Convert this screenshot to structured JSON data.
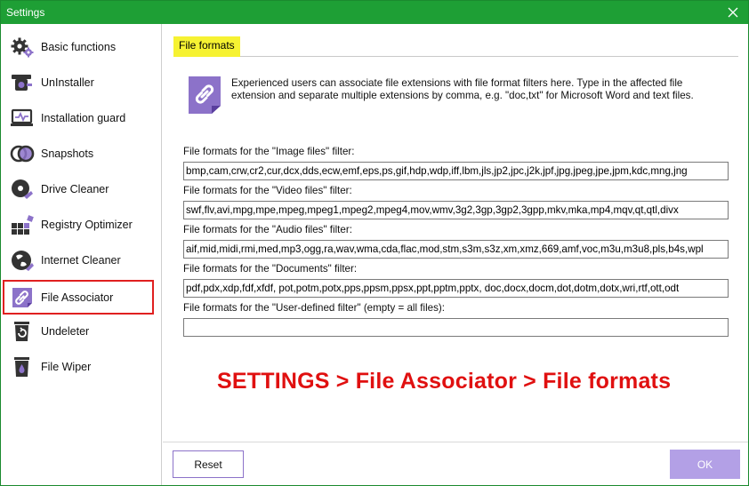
{
  "window": {
    "title": "Settings"
  },
  "sidebar": {
    "items": [
      {
        "label": "Basic functions",
        "icon": "gear-icon"
      },
      {
        "label": "UnInstaller",
        "icon": "uninstaller-icon"
      },
      {
        "label": "Installation guard",
        "icon": "installation-guard-icon"
      },
      {
        "label": "Snapshots",
        "icon": "snapshots-icon"
      },
      {
        "label": "Drive Cleaner",
        "icon": "drive-cleaner-icon"
      },
      {
        "label": "Registry Optimizer",
        "icon": "registry-optimizer-icon"
      },
      {
        "label": "Internet Cleaner",
        "icon": "internet-cleaner-icon"
      },
      {
        "label": "File Associator",
        "icon": "file-associator-icon",
        "selected": true
      },
      {
        "label": "Undeleter",
        "icon": "undeleter-icon"
      },
      {
        "label": "File Wiper",
        "icon": "file-wiper-icon"
      }
    ]
  },
  "section": {
    "title": "File formats",
    "description": "Experienced users can associate file extensions with file format filters here. Type in the affected file extension and separate multiple extensions by comma, e.g. \"doc,txt\" for Microsoft Word and text files."
  },
  "fields": [
    {
      "label": "File formats for the \"Image files\" filter:",
      "value": "bmp,cam,crw,cr2,cur,dcx,dds,ecw,emf,eps,ps,gif,hdp,wdp,iff,lbm,jls,jp2,jpc,j2k,jpf,jpg,jpeg,jpe,jpm,kdc,mng,jng"
    },
    {
      "label": "File formats for the \"Video files\" filter:",
      "value": "swf,flv,avi,mpg,mpe,mpeg,mpeg1,mpeg2,mpeg4,mov,wmv,3g2,3gp,3gp2,3gpp,mkv,mka,mp4,mqv,qt,qtl,divx"
    },
    {
      "label": "File formats for the \"Audio files\" filter:",
      "value": "aif,mid,midi,rmi,med,mp3,ogg,ra,wav,wma,cda,flac,mod,stm,s3m,s3z,xm,xmz,669,amf,voc,m3u,m3u8,pls,b4s,wpl"
    },
    {
      "label": "File formats for the \"Documents\" filter:",
      "value": "pdf,pdx,xdp,fdf,xfdf, pot,potm,potx,pps,ppsm,ppsx,ppt,pptm,pptx, doc,docx,docm,dot,dotm,dotx,wri,rtf,ott,odt"
    },
    {
      "label": "File formats for the \"User-defined filter\" (empty = all files):",
      "value": ""
    }
  ],
  "caption": "SETTINGS > File Associator > File formats",
  "buttons": {
    "reset": "Reset",
    "ok": "OK"
  },
  "colors": {
    "titlebar": "#1e9f35",
    "accent_purple": "#8c72c9",
    "highlight_yellow": "#f6f232",
    "selection_red": "#e02020",
    "caption_red": "#e01010"
  }
}
